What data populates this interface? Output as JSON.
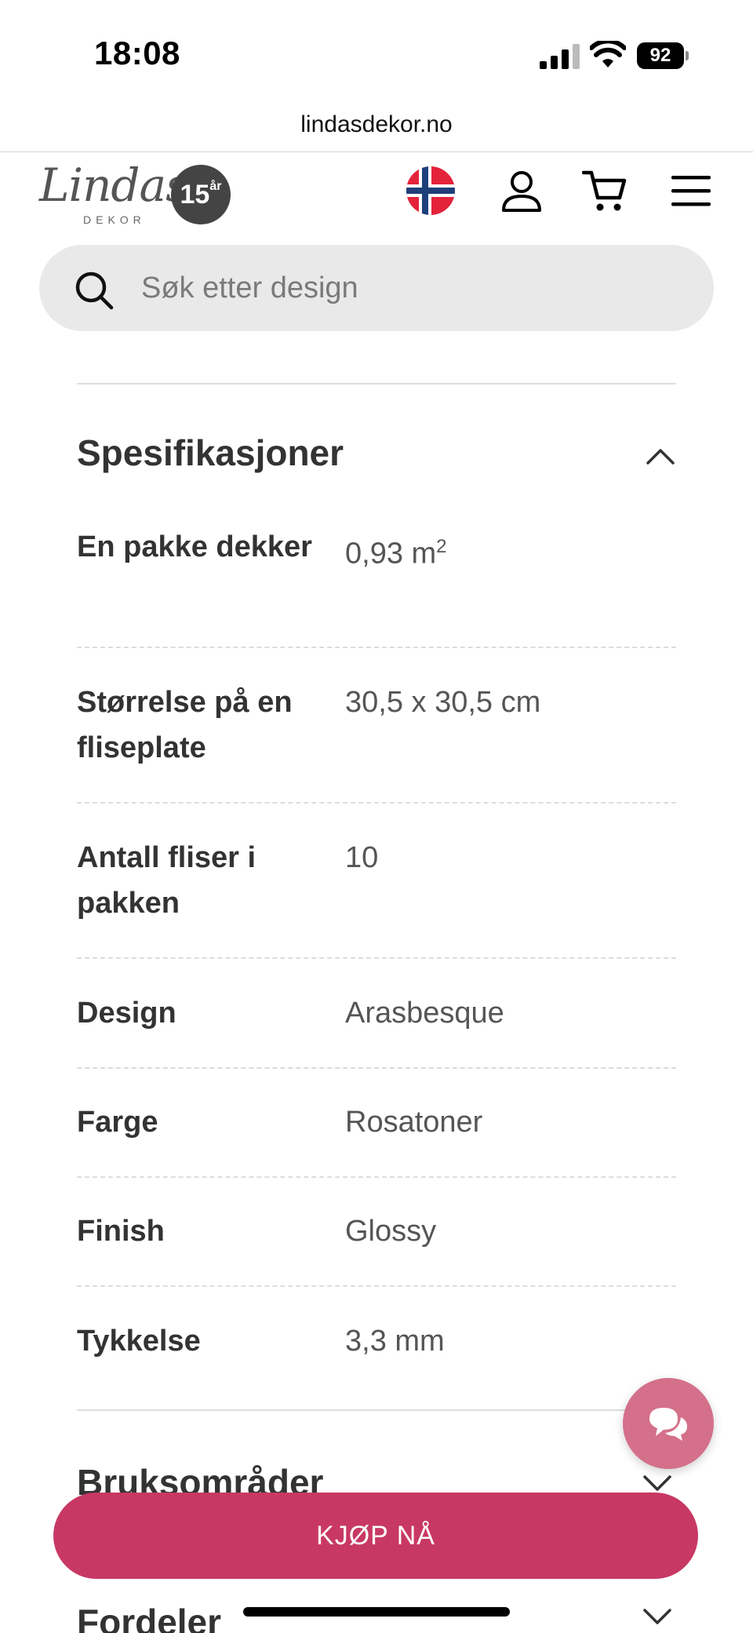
{
  "status_bar": {
    "time": "18:08",
    "battery": "92"
  },
  "browser": {
    "url": "lindasdekor.no"
  },
  "header": {
    "logo_text": "Lindas",
    "logo_subtext": "DEKOR",
    "logo_badge_number": "15",
    "logo_badge_suffix": "år",
    "icons": [
      "norway-flag-icon",
      "user-icon",
      "cart-icon",
      "menu-icon"
    ]
  },
  "search": {
    "placeholder": "Søk etter design"
  },
  "specifications": {
    "title": "Spesifikasjoner",
    "expanded": true,
    "rows": [
      {
        "key": "En pakke dekker",
        "value": "0,93 m",
        "value_sup": "2"
      },
      {
        "key": "Størrelse på en fliseplate",
        "value": "30,5 x 30,5 cm"
      },
      {
        "key": "Antall fliser i pakken",
        "value": "10"
      },
      {
        "key": "Design",
        "value": "Arasbesque"
      },
      {
        "key": "Farge",
        "value": "Rosatoner"
      },
      {
        "key": "Finish",
        "value": "Glossy"
      },
      {
        "key": "Tykkelse",
        "value": "3,3 mm"
      }
    ]
  },
  "accordions": [
    {
      "title": "Bruksområder",
      "expanded": false
    },
    {
      "title": "Fordeler",
      "expanded": false
    }
  ],
  "buy_button": {
    "label": "KJØP NÅ"
  },
  "colors": {
    "accent": "#c83865",
    "chat": "#d4708a",
    "text": "#333333"
  }
}
